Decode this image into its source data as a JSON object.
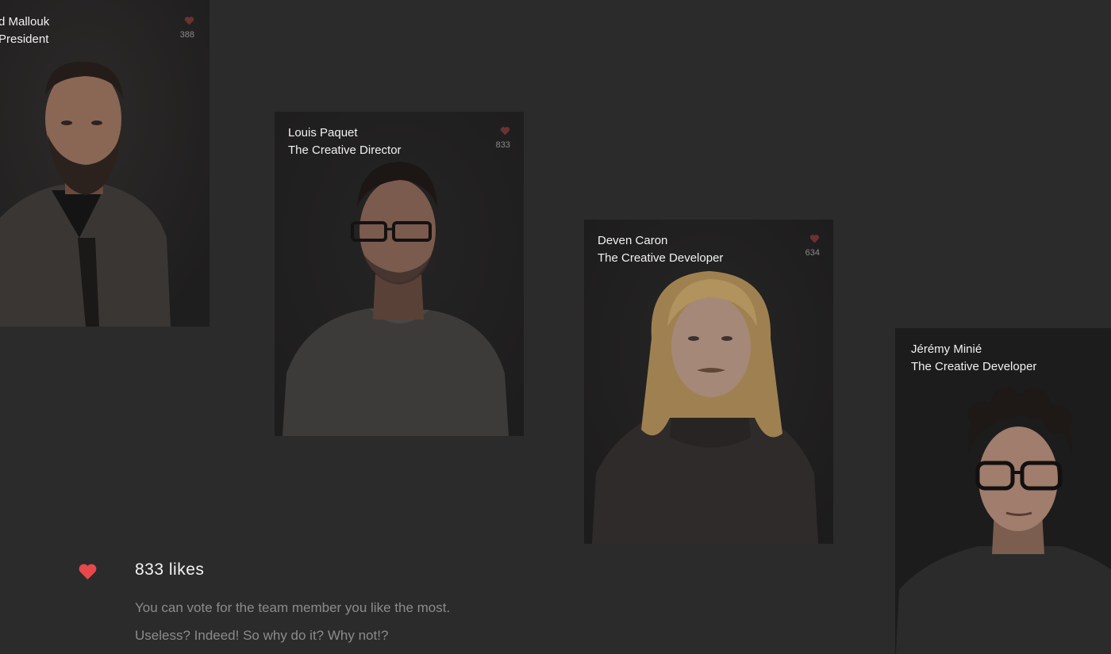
{
  "cards": [
    {
      "name": "d Mallouk",
      "role": "President",
      "likes": "388"
    },
    {
      "name": "Louis Paquet",
      "role": "The Creative Director",
      "likes": "833"
    },
    {
      "name": "Deven Caron",
      "role": "The Creative Developer",
      "likes": "634"
    },
    {
      "name": "Jérémy Minié",
      "role": "The Creative Developer"
    }
  ],
  "vote": {
    "likes_text": "833 likes",
    "description_line1": "You can vote for the team member you like the most.",
    "description_line2": "Useless? Indeed! So why do it? Why not!?"
  },
  "colors": {
    "background": "#2b2b2b",
    "card": "#232323",
    "heart_active": "#e8474b",
    "heart_muted": "#6b3231",
    "text_primary": "#f1f1f1",
    "text_muted": "#8b8b8b"
  },
  "icons": {
    "card_like": "heart-icon",
    "vote_like": "heart-icon"
  }
}
